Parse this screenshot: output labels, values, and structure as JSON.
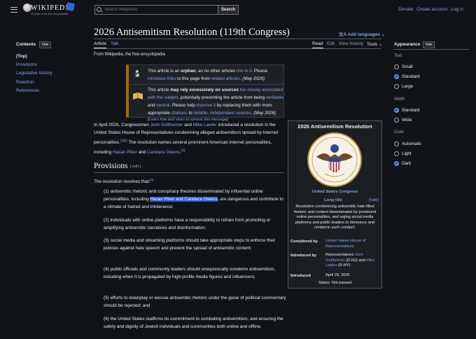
{
  "header": {
    "wordmark": "WIKIPEDIA",
    "tagline": "25 years of the free encyclopedia",
    "search_placeholder": "Search Wikipedia",
    "search_button": "Search",
    "links": [
      "Donate",
      "Create account",
      "Log in"
    ]
  },
  "toc": {
    "title": "Contents",
    "hide": "hide",
    "items": [
      "(Top)",
      "Provisions",
      "Legislative history",
      "Reaction",
      "References"
    ]
  },
  "article": {
    "title": "2026 Antisemitism Resolution (119th Congress)",
    "languages": "Add languages",
    "tabs_left": [
      "Article",
      "Talk"
    ],
    "tabs_right": [
      "Read",
      "Edit",
      "View history",
      "Tools"
    ],
    "from": "From Wikipedia, the free encyclopedia",
    "orphan": {
      "p1": "This article is an ",
      "bold": "orphan",
      "p2": ", as no other articles ",
      "l1": "link to it",
      "p3": ". Please ",
      "l2": "introduce links",
      "p4": " to this page from ",
      "l3": "related articles",
      "p5": ". ",
      "date": "(May 2026)"
    },
    "reliance": {
      "p1": "This article ",
      "bold": "may rely excessively on sources",
      "l1": "too closely associated with the subject",
      "p2": ", potentially preventing the article from being ",
      "l2": "verifiable",
      "p3": " and ",
      "l3": "neutral",
      "p4": ". Please help ",
      "l4": "improve it",
      "p5": " by replacing them with more appropriate ",
      "l5": "citations",
      "p6": " to ",
      "l6": "reliable, independent sources",
      "p7": ". ",
      "date": "(May 2026)",
      "learn": "Learn how and when to remove this message"
    },
    "intro": {
      "t1": "In April 2026, Congressmen ",
      "l1": "Josh Gottheimer",
      "t2": " and ",
      "l2": "Mike Lawler",
      "t3": " introduced a resolution in the United States House of Representatives condemning alleged antisemitism spread by Internet personalities.",
      "r1": "[1][2]",
      "t4": " The resolution names several prominent American internet personalities, including ",
      "l3": "Hasan Piker",
      "t5": " and ",
      "l4": "Candace Owens",
      "t6": ".",
      "r2": "[3]"
    },
    "provisions_heading": "Provisions",
    "edit": "[ edit ]",
    "resolves": "The resolution resolves that:",
    "resolves_ref": "[4]",
    "item1_a": "(1) antisemitic rhetoric and conspiracy theories disseminated by influential online personalities, including ",
    "item1_hl": "Hasan Piker and Candace Owens",
    "item1_b": ", are dangerous and contribute to a climate of hatred and intolerance;",
    "item2": "(2) individuals with online platforms have a responsibility to refrain from promoting or amplifying antisemitic narratives and disinformation;",
    "item3": "(3) social media and streaming platforms should take appropriate steps to enforce their policies against hate speech and prevent the spread of antisemitic content;",
    "item4": "(4) public officials and community leaders should unequivocally condemn antisemitism, including when it is propagated by high-profile media figures and influencers;",
    "item5": "(5) efforts to downplay or excuse antisemitic rhetoric under the guise of political commentary should be rejected; and",
    "item6": "(6) the United States reaffirms its commitment to combating antisemitism, and ensuring the safety and dignity of Jewish individuals and communities both online and offline."
  },
  "infobox": {
    "title": "2026 Antisemitism Resolution",
    "caption": "United States Congress",
    "long_title": "Long title",
    "hide": "[hide]",
    "description": "Resolution condemning antisemitic hate-filled rhetoric and content disseminated by prominent online personalities, and urging social media platforms and public leaders to denounce and condemn such conduct.",
    "considered_label": "Considered by",
    "considered_value": "United States House of Representatives",
    "introduced_by_label": "Introduced by",
    "introduced_by_a": "Representatives ",
    "introduced_by_l1": "Josh Gottheimer",
    "introduced_by_b": " (D-NJ) and ",
    "introduced_by_l2": "Mike Lawler",
    "introduced_by_c": " (R-NY)",
    "introduced_label": "Introduced",
    "introduced_value": "April 29, 2026",
    "status": "Status: Not passed"
  },
  "appearance": {
    "title": "Appearance",
    "hide": "hide",
    "text_label": "Text",
    "text_options": [
      "Small",
      "Standard",
      "Large"
    ],
    "text_selected": "Standard",
    "width_label": "Width",
    "width_options": [
      "Standard",
      "Wide"
    ],
    "width_selected": "Standard",
    "color_label": "Color",
    "color_options": [
      "Automatic",
      "Light",
      "Dark"
    ],
    "color_selected": "Dark"
  },
  "colors": {
    "background": "#101418",
    "link": "#88a3e8",
    "highlight": "#2a5bd7"
  }
}
